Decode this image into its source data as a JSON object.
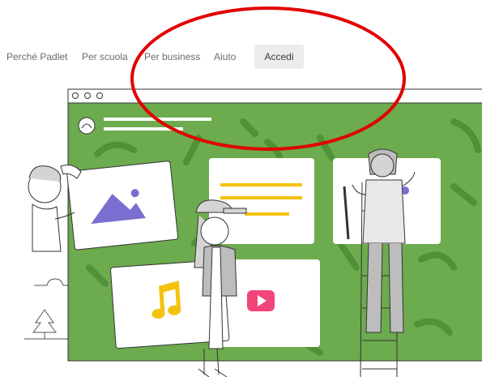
{
  "nav": {
    "items": [
      {
        "label": "Perché Padlet"
      },
      {
        "label": "Per scuola"
      },
      {
        "label": "Per business"
      },
      {
        "label": "Aiuto"
      }
    ],
    "login_label": "Accedi"
  },
  "hero": {
    "window_dots": 3,
    "cards": [
      "image-card",
      "text-card",
      "pin-card",
      "music-card",
      "video-card"
    ],
    "icons": [
      "mountain-icon",
      "music-note-icon",
      "play-icon",
      "tree-icon",
      "cloud-icon"
    ]
  },
  "annotation": {
    "shape": "ellipse",
    "color": "#e10000"
  },
  "colors": {
    "board_green": "#6cab4e",
    "accent_purple": "#7a6fd1",
    "accent_yellow": "#f4c20d",
    "video_red": "#f2457a",
    "login_bg": "#ececec"
  }
}
